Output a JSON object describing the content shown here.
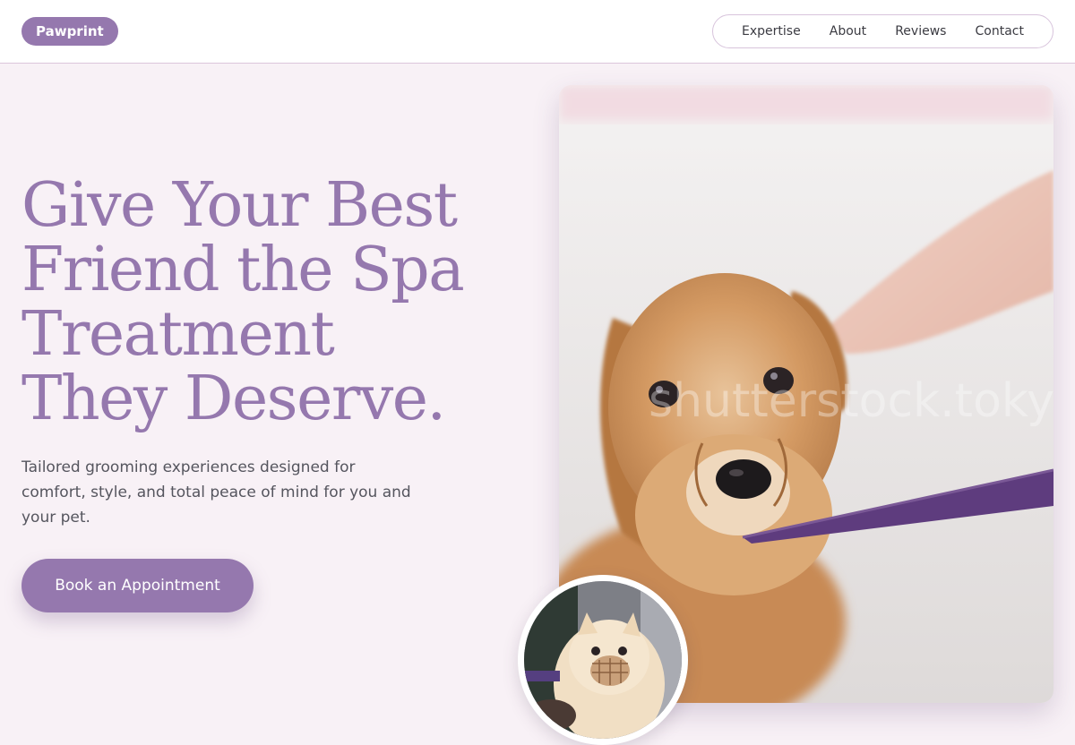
{
  "brand": {
    "name": "Pawprint",
    "accent": "#9578ae"
  },
  "nav": {
    "items": [
      "Expertise",
      "About",
      "Reviews",
      "Contact"
    ]
  },
  "hero": {
    "headline": "Give Your Best Friend the Spa Treatment They Deserve.",
    "subtext": "Tailored grooming experiences designed for comfort, style, and total peace of mind for you and your pet.",
    "cta_label": "Book an Appointment"
  },
  "images": {
    "main_photo": "wet-dog-with-purple-leash",
    "main_watermark": "shutterstock.tokyo",
    "avatar_photo": "pomeranian-with-muzzle"
  }
}
